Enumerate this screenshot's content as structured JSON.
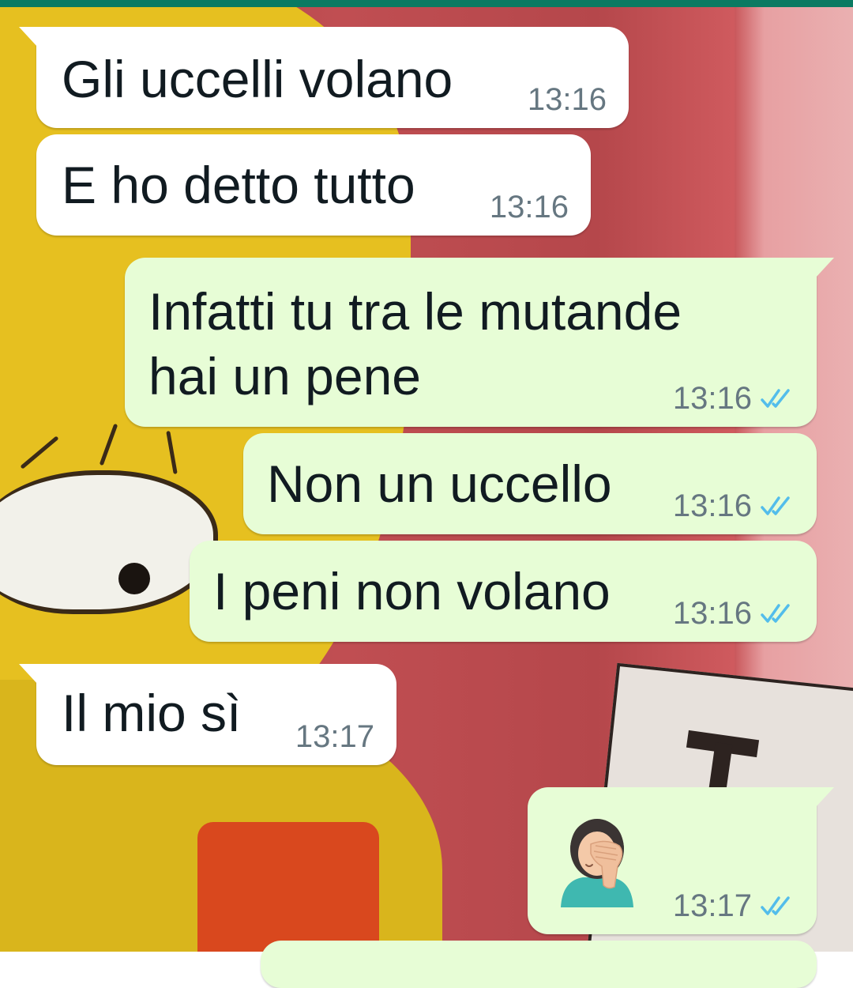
{
  "messages": [
    {
      "direction": "incoming",
      "text": "Gli uccelli volano",
      "time": "13:16"
    },
    {
      "direction": "incoming",
      "text": "E ho detto tutto",
      "time": "13:16"
    },
    {
      "direction": "outgoing",
      "lines": [
        "Infatti tu tra le mutande",
        "hai un pene"
      ],
      "time": "13:16",
      "status_icon": "double-check-icon"
    },
    {
      "direction": "outgoing",
      "text": "Non un uccello",
      "time": "13:16",
      "status_icon": "double-check-icon"
    },
    {
      "direction": "outgoing",
      "text": "I peni non volano",
      "time": "13:16",
      "status_icon": "double-check-icon"
    },
    {
      "direction": "incoming",
      "text": "Il mio sì",
      "time": "13:17"
    },
    {
      "direction": "outgoing",
      "emoji": "facepalm-woman-emoji",
      "time": "13:17",
      "status_icon": "double-check-icon"
    }
  ],
  "colors": {
    "incoming_bubble": "#ffffff",
    "outgoing_bubble": "#e7fdd6",
    "text": "#111b21",
    "timestamp": "#667781",
    "read_check": "#53bdeb",
    "top_bar": "#0b7a62"
  }
}
